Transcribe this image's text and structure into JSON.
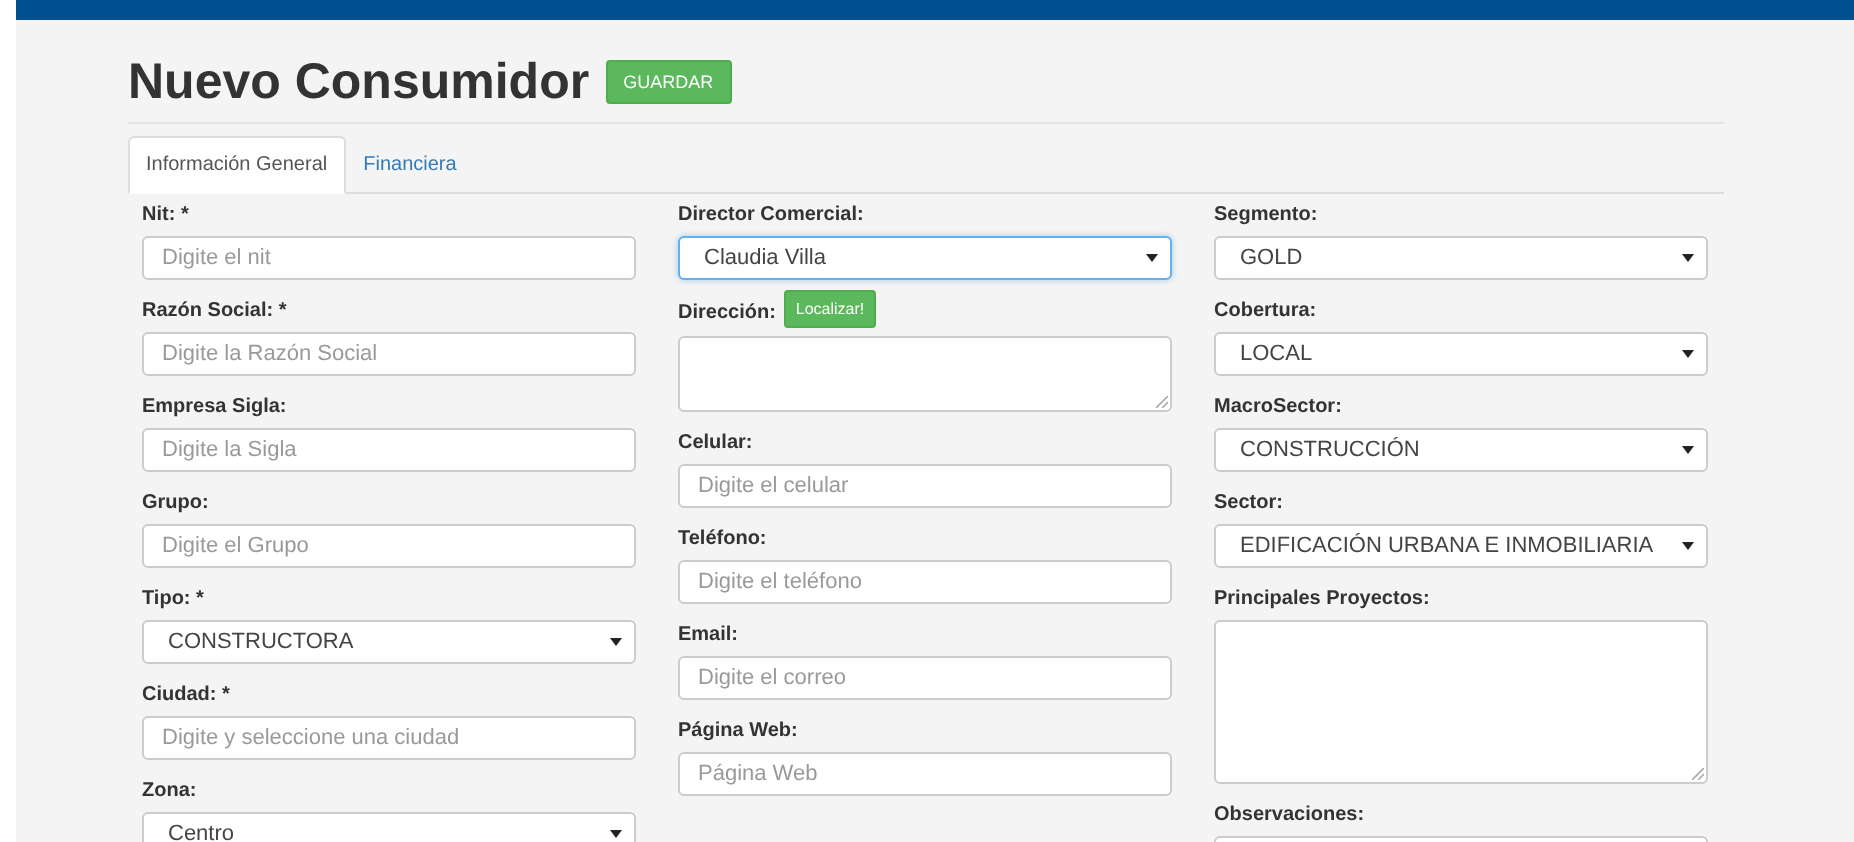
{
  "page": {
    "title": "Nuevo Consumidor",
    "save_button": "GUARDAR"
  },
  "tabs": [
    {
      "label": "Información General",
      "selected": true
    },
    {
      "label": "Financiera",
      "selected": false
    }
  ],
  "columns": [
    {
      "fields": [
        {
          "label": "Nit: *",
          "kind": "input",
          "placeholder": "Digite el nit",
          "focused": false
        },
        {
          "label": "Razón Social: *",
          "kind": "input",
          "placeholder": "Digite la Razón Social",
          "focused": false
        },
        {
          "label": "Empresa Sigla:",
          "kind": "input",
          "placeholder": "Digite la Sigla",
          "focused": false
        },
        {
          "label": "Grupo:",
          "kind": "input",
          "placeholder": "Digite el Grupo",
          "focused": false
        },
        {
          "label": "Tipo: *",
          "kind": "select",
          "value": "CONSTRUCTORA",
          "focused": false
        },
        {
          "label": "Ciudad: *",
          "kind": "input",
          "placeholder": "Digite y seleccione una ciudad",
          "focused": false
        },
        {
          "label": "Zona:",
          "kind": "select",
          "value": "Centro",
          "focused": false
        }
      ]
    },
    {
      "fields": [
        {
          "label": "Director Comercial:",
          "kind": "select",
          "value": "Claudia Villa",
          "focused": true
        },
        {
          "label": "Dirección:",
          "kind": "textarea",
          "button": "Localizar!",
          "focused": false
        },
        {
          "label": "Celular:",
          "kind": "input",
          "placeholder": "Digite el celular",
          "focused": false
        },
        {
          "label": "Teléfono:",
          "kind": "input",
          "placeholder": "Digite el teléfono",
          "focused": false
        },
        {
          "label": "Email:",
          "kind": "input",
          "placeholder": "Digite el correo",
          "focused": false
        },
        {
          "label": "Página Web:",
          "kind": "input",
          "placeholder": "Página Web",
          "focused": false
        }
      ]
    },
    {
      "fields": [
        {
          "label": "Segmento:",
          "kind": "select",
          "value": "GOLD",
          "focused": false
        },
        {
          "label": "Cobertura:",
          "kind": "select",
          "value": "LOCAL",
          "focused": false
        },
        {
          "label": "MacroSector:",
          "kind": "select",
          "value": "CONSTRUCCIÓN",
          "focused": false
        },
        {
          "label": "Sector:",
          "kind": "select",
          "value": "EDIFICACIÓN URBANA E INMOBILIARIA",
          "focused": false
        },
        {
          "label": "Principales Proyectos:",
          "kind": "textarea",
          "tall": true,
          "focused": false
        },
        {
          "label": "Observaciones:",
          "kind": "textarea"
        }
      ]
    }
  ]
}
